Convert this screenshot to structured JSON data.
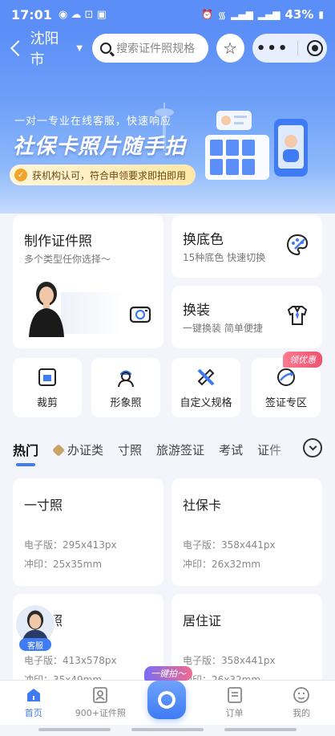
{
  "status_bar": {
    "time": "17:01",
    "battery": "43%"
  },
  "nav": {
    "city": "沈阳市",
    "search_placeholder": "搜索证件照规格"
  },
  "banner": {
    "subtitle": "一对一专业在线客服，快速响应",
    "title": "社保卡照片随手拍",
    "badge": "获机构认可，符合申领要求即拍即用"
  },
  "features": {
    "make": {
      "title": "制作证件照",
      "subtitle": "多个类型任你选择～"
    },
    "background": {
      "title": "换底色",
      "subtitle": "15种底色 快速切换"
    },
    "outfit": {
      "title": "换装",
      "subtitle": "一键换装 简单便捷"
    }
  },
  "tools": [
    {
      "label": "裁剪",
      "icon": "crop-icon"
    },
    {
      "label": "形象照",
      "icon": "portrait-icon"
    },
    {
      "label": "自定义规格",
      "icon": "ruler-pencil-icon"
    },
    {
      "label": "签证专区",
      "icon": "globe-plane-icon",
      "tag": "领优惠"
    }
  ],
  "tabs": [
    {
      "label": "热门",
      "active": true
    },
    {
      "label": "办证类"
    },
    {
      "label": "寸照"
    },
    {
      "label": "旅游签证"
    },
    {
      "label": "考试"
    },
    {
      "label": "证件"
    }
  ],
  "specs": [
    {
      "name": "一寸照",
      "digital": "电子版：295x413px",
      "print": "冲印：25x35mm"
    },
    {
      "name": "社保卡",
      "digital": "电子版：358x441px",
      "print": "冲印：26x32mm"
    },
    {
      "name": "照",
      "digital": "电子版：413x578px",
      "print": "冲印：35x49mm"
    },
    {
      "name": "居住证",
      "digital": "电子版：358x441px",
      "print": "冲印：26x32mm"
    }
  ],
  "customer_service": {
    "label": "客服"
  },
  "bottom_nav": {
    "items": [
      {
        "label": "首页",
        "icon": "home-icon",
        "active": true
      },
      {
        "label": "900+证件照",
        "icon": "id-photo-icon"
      },
      {
        "label": "订单",
        "icon": "order-icon"
      },
      {
        "label": "我的",
        "icon": "profile-icon"
      }
    ],
    "fab_tag": "一键拍～"
  },
  "colors": {
    "brand_blue": "#3f7bf3",
    "header_blue": "#5b8ef7",
    "promo_pink": "#f0506e"
  }
}
